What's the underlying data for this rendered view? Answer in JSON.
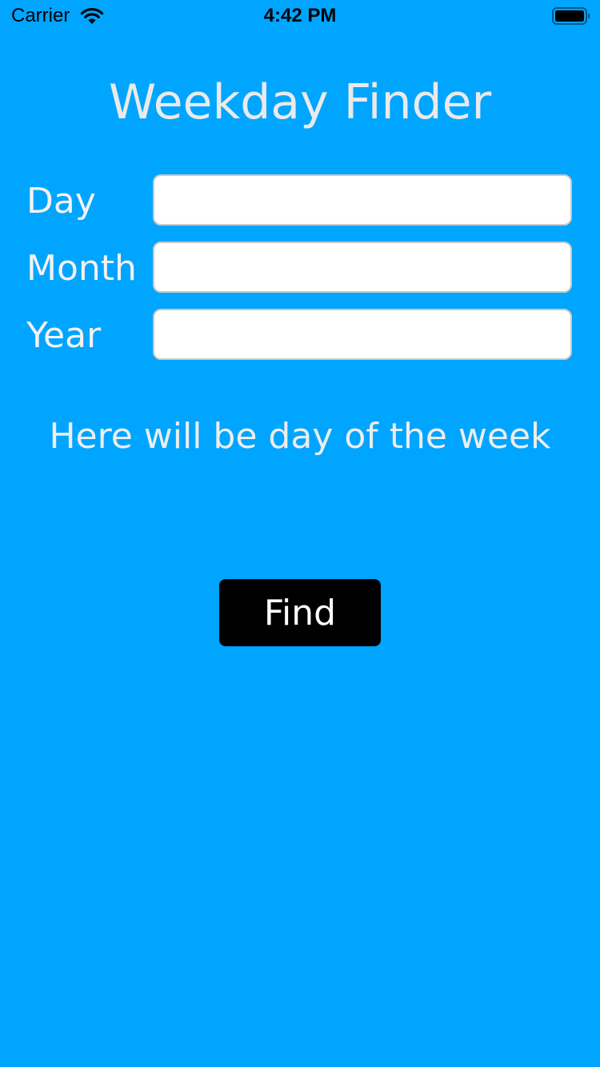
{
  "status_bar": {
    "carrier": "Carrier",
    "time": "4:42 PM",
    "wifi_icon": "wifi-icon",
    "battery_icon": "battery-icon"
  },
  "title": "Weekday Finder",
  "fields": {
    "day": {
      "label": "Day",
      "value": "",
      "placeholder": ""
    },
    "month": {
      "label": "Month",
      "value": "",
      "placeholder": ""
    },
    "year": {
      "label": "Year",
      "value": "",
      "placeholder": ""
    }
  },
  "result_text": "Here will be day of the week",
  "find_button_label": "Find",
  "colors": {
    "background": "#00A5FF",
    "button": "#000000",
    "button_text": "#FFFFFF",
    "label_text": "#F2F2F2"
  }
}
